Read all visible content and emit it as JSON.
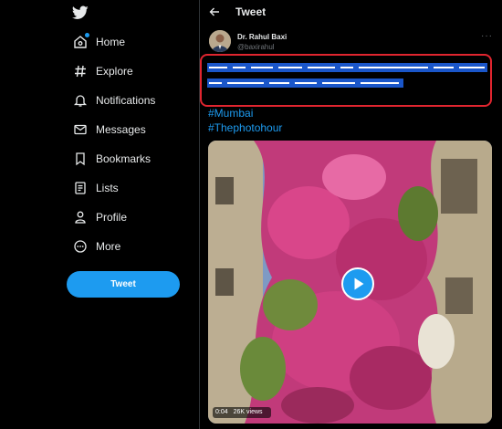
{
  "sidebar": {
    "logo_icon": "twitter-bird-icon",
    "items": [
      {
        "label": "Home",
        "icon": "home-icon"
      },
      {
        "label": "Explore",
        "icon": "hashtag-icon"
      },
      {
        "label": "Notifications",
        "icon": "bell-icon"
      },
      {
        "label": "Messages",
        "icon": "envelope-icon"
      },
      {
        "label": "Bookmarks",
        "icon": "bookmark-icon"
      },
      {
        "label": "Lists",
        "icon": "list-icon"
      },
      {
        "label": "Profile",
        "icon": "person-icon"
      },
      {
        "label": "More",
        "icon": "more-circle-icon"
      }
    ],
    "tweet_button": "Tweet"
  },
  "header": {
    "back_icon": "back-arrow-icon",
    "title": "Tweet"
  },
  "tweet": {
    "author_name": "Dr. Rahul Baxi",
    "author_handle": "@baxirahul",
    "more_icon": "ellipsis-icon",
    "more_label": "···",
    "hashtags": [
      "#Mumbai",
      "#Thephotohour"
    ],
    "video": {
      "duration": "0:04",
      "views": "26K views"
    }
  },
  "colors": {
    "background": "#000000",
    "accent": "#1d9bf0",
    "text": "#e7e9ea",
    "muted": "#71767b",
    "redaction_border": "#e0252f",
    "redaction_fill": "#1a56c9"
  }
}
